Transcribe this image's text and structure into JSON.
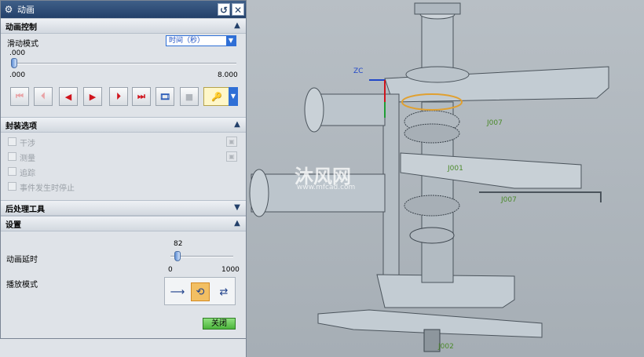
{
  "dialog": {
    "title": "动画",
    "reset_icon": "reset-icon",
    "close_icon": "close-icon"
  },
  "animation_control": {
    "header": "动画控制",
    "slide_mode_label": "滑动模式",
    "slide_mode_value": "时间（秒）",
    "current_time": ".000",
    "range_min": ".000",
    "range_max": "8.000",
    "position_fraction": 0,
    "buttons": [
      "rewind-to-start",
      "step-back",
      "play-reverse",
      "play-forward",
      "step-forward",
      "fast-forward",
      "record-movie",
      "stop",
      "loop-option"
    ]
  },
  "encapsulation": {
    "header": "封装选项",
    "options": [
      "干涉",
      "测量",
      "追踪",
      "事件发生时停止"
    ]
  },
  "post_processing": {
    "header": "后处理工具"
  },
  "settings": {
    "header": "设置",
    "delay_label": "动画延时",
    "delay_value": "82",
    "delay_min": "0",
    "delay_max": "1000",
    "delay_fraction": 0.082,
    "playback_label": "播放模式",
    "playback_modes": [
      "play-once",
      "loop",
      "reverse-loop"
    ],
    "playback_active": "loop"
  },
  "close_button": "关闭",
  "viewport": {
    "axis_label": "ZC",
    "watermark": "沐风网",
    "watermark_url": "www.mfcad.com",
    "part_labels": [
      "J007",
      "J001",
      "J007",
      "J002"
    ]
  },
  "colors": {
    "title_bar": "#23406a",
    "close_button": "#4cb53c",
    "accent_blue": "#2f6fd6"
  }
}
